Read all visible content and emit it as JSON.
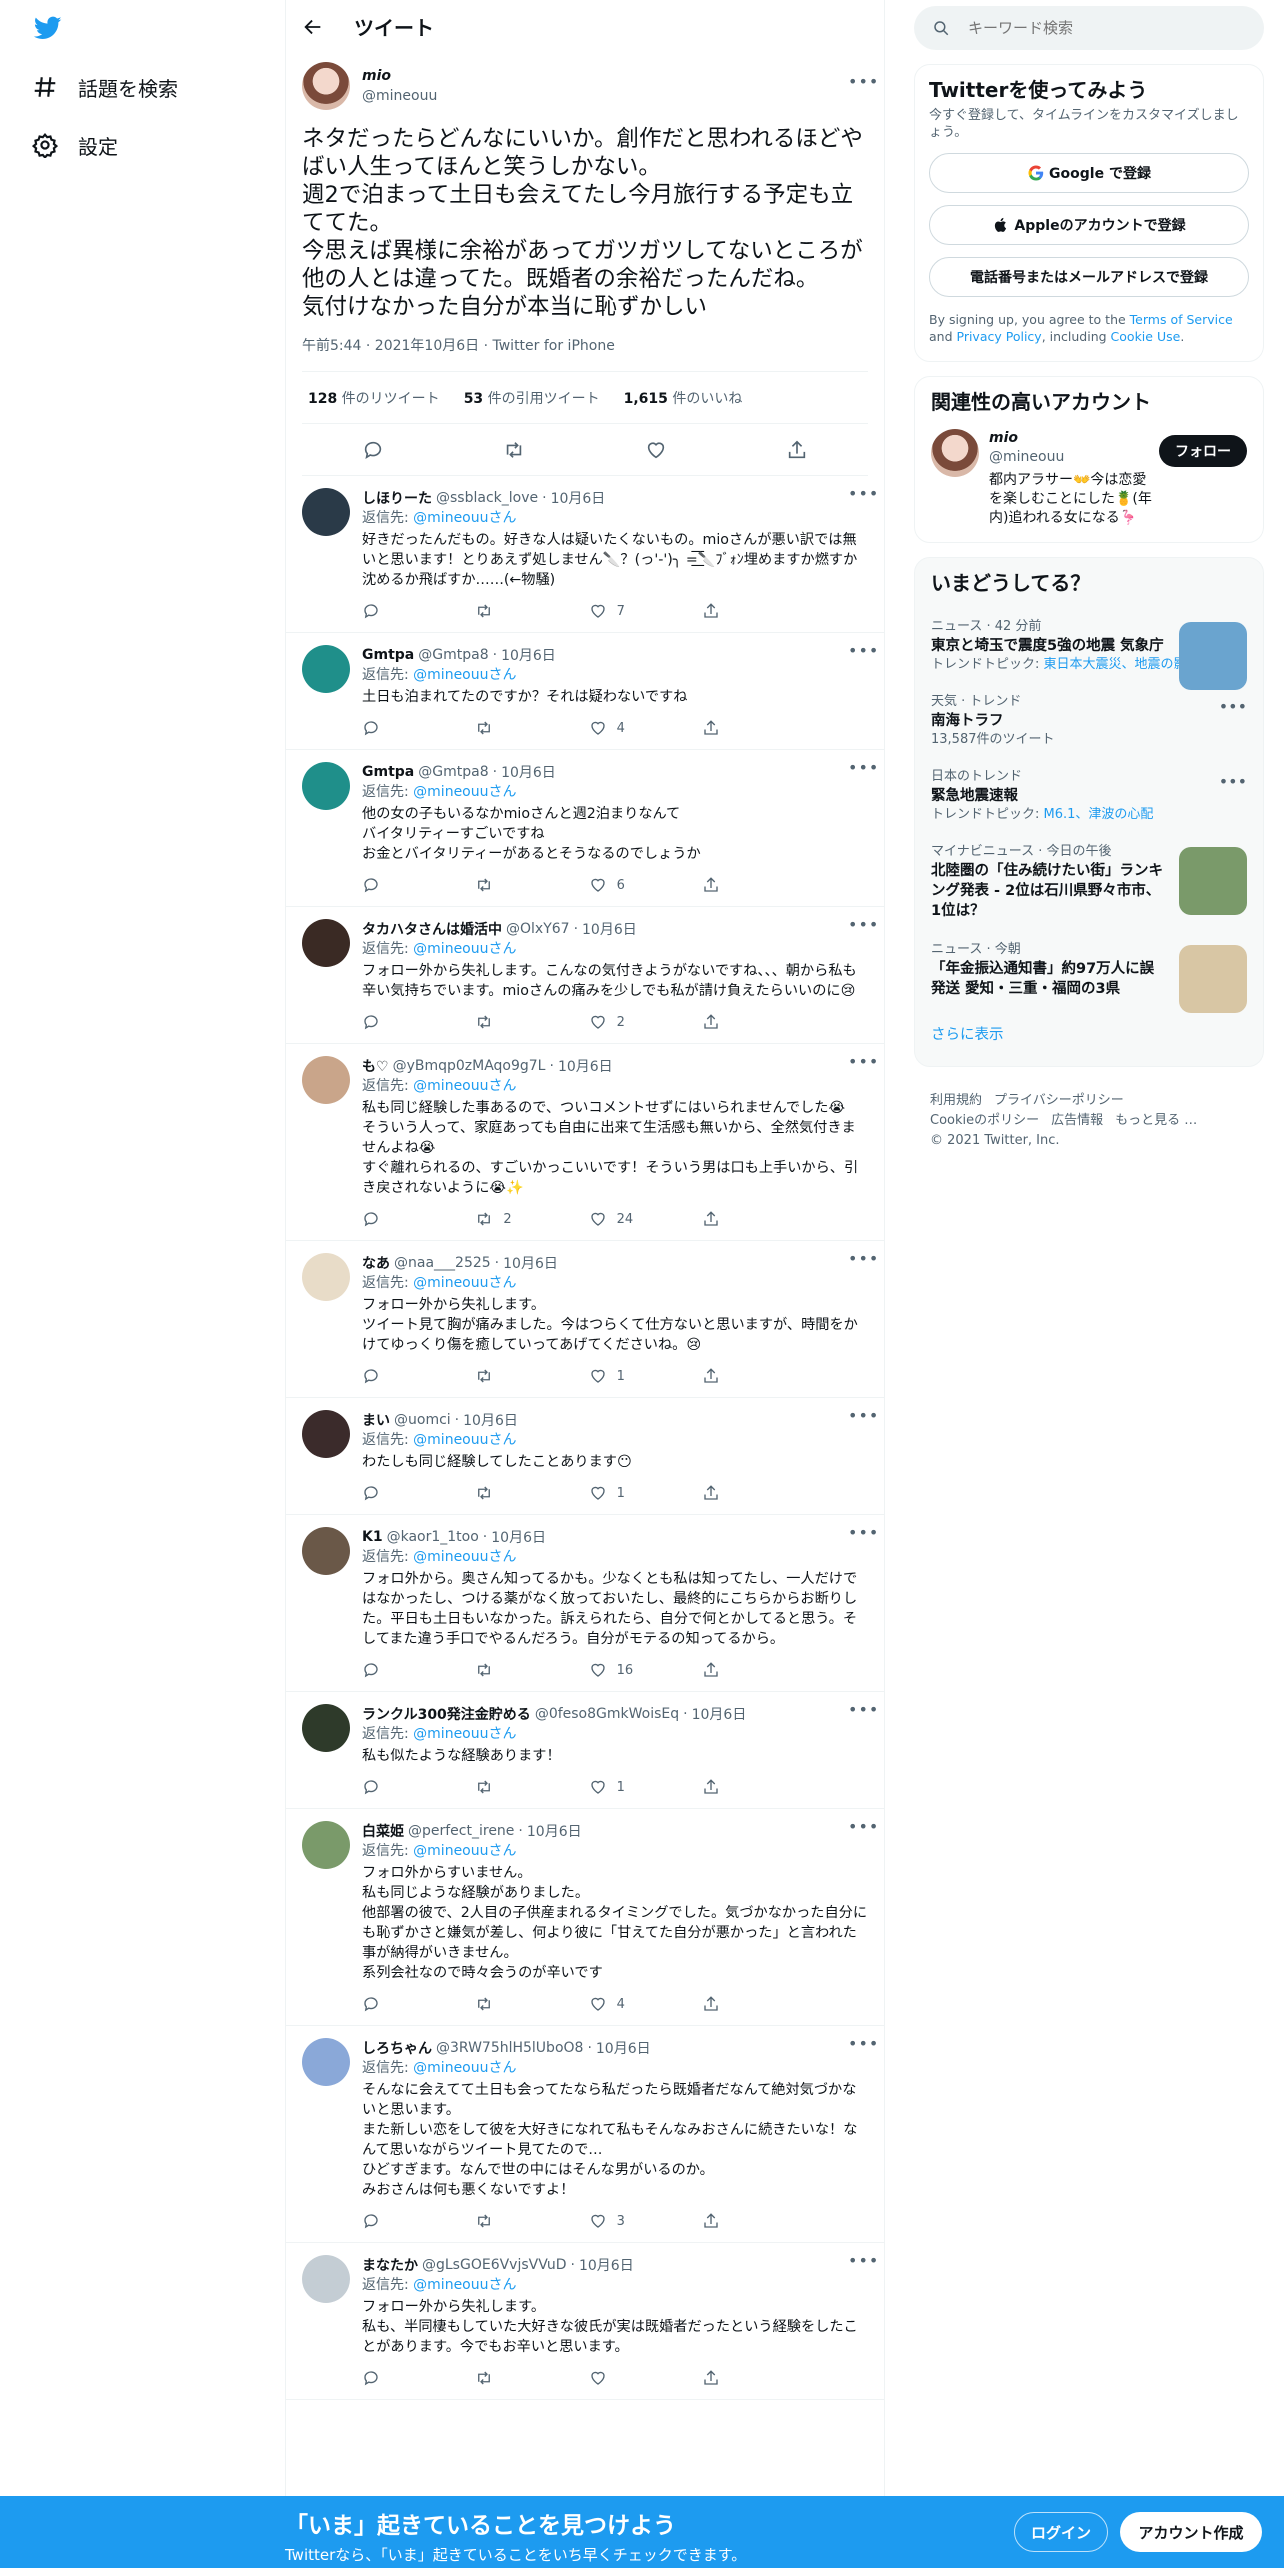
{
  "colors": {
    "brand": "#1d9bf0",
    "text": "#0f1419",
    "muted": "#536471"
  },
  "nav": {
    "logo_icon": "twitter-bird-icon",
    "explore_label": "話題を検索",
    "settings_label": "設定"
  },
  "header": {
    "title": "ツイート"
  },
  "main_tweet": {
    "name": "mio",
    "handle": "@mineouu",
    "text": "ネタだったらどんなにいいか。創作だと思われるほどやばい人生ってほんと笑うしかない。\n週2で泊まって土日も会えてたし今月旅行する予定も立ててた。\n今思えば異様に余裕があってガツガツしてないところが他の人とは違ってた。既婚者の余裕だったんだね。\n気付けなかった自分が本当に恥ずかしい",
    "meta": "午前5:44 · 2021年10月6日 · Twitter for iPhone",
    "retweets_num": "128",
    "retweets_label": " 件のリツイート",
    "quotes_num": "53",
    "quotes_label": " 件の引用ツイート",
    "likes_num": "1,615",
    "likes_label": " 件のいいね"
  },
  "replies": [
    {
      "name": "しほりーた",
      "handle": "@ssblack_love",
      "date": "10月6日",
      "reply_prefix": "返信先: ",
      "reply_to": "@mineouuさん",
      "text": "好きだったんだもの。好きな人は疑いたくないもの。mioさんが悪い訳では無いと思います！とりあえず処しません🔪？(っ'-')╮ =͟͟͞͞🔪ﾌﾞｫﾝ埋めますか燃すか沈めるか飛ばすか……(←物騒)",
      "likes": "7",
      "retweets": "",
      "replies": "",
      "avatar_color": "#2a3a48"
    },
    {
      "name": "Gmtpa",
      "handle": "@Gmtpa8",
      "date": "10月6日",
      "reply_prefix": "返信先: ",
      "reply_to": "@mineouuさん",
      "text": "土日も泊まれてたのですか？それは疑わないですね",
      "likes": "4",
      "retweets": "",
      "replies": "",
      "avatar_color": "#1f8f8a"
    },
    {
      "name": "Gmtpa",
      "handle": "@Gmtpa8",
      "date": "10月6日",
      "reply_prefix": "返信先: ",
      "reply_to": "@mineouuさん",
      "text": "他の女の子もいるなかmioさんと週2泊まりなんて\nバイタリティーすごいですね\nお金とバイタリティーがあるとそうなるのでしょうか",
      "likes": "6",
      "retweets": "",
      "replies": "",
      "avatar_color": "#1f8f8a"
    },
    {
      "name": "タカハタさんは婚活中",
      "handle": "@OlxY67",
      "date": "10月6日",
      "reply_prefix": "返信先: ",
      "reply_to": "@mineouuさん",
      "text": "フォロー外から失礼します。こんなの気付きようがないですね、、、朝から私も辛い気持ちでいます。mioさんの痛みを少しでも私が請け負えたらいいのに😢",
      "likes": "2",
      "retweets": "",
      "replies": "",
      "avatar_color": "#3a2a24"
    },
    {
      "name": "も♡",
      "handle": "@yBmqp0zMAqo9g7L",
      "date": "10月6日",
      "reply_prefix": "返信先: ",
      "reply_to": "@mineouuさん",
      "text": "私も同じ経験した事あるので、ついコメントせずにはいられませんでした😭\nそういう人って、家庭あっても自由に出来て生活感も無いから、全然気付きませんよね😭\nすぐ離れられるの、すごいかっこいいです！そういう男は口も上手いから、引き戻されないように😭✨",
      "likes": "24",
      "retweets": "2",
      "replies": "",
      "avatar_color": "#c9a58a"
    },
    {
      "name": "なあ",
      "handle": "@naa___2525",
      "date": "10月6日",
      "reply_prefix": "返信先: ",
      "reply_to": "@mineouuさん",
      "text": "フォロー外から失礼します。\nツイート見て胸が痛みました。今はつらくて仕方ないと思いますが、時間をかけてゆっくり傷を癒していってあげてくださいね。😢",
      "likes": "1",
      "retweets": "",
      "replies": "",
      "avatar_color": "#e8dcc8"
    },
    {
      "name": "まい",
      "handle": "@uomci",
      "date": "10月6日",
      "reply_prefix": "返信先: ",
      "reply_to": "@mineouuさん",
      "text": "わたしも同じ経験してしたことあります😶",
      "likes": "1",
      "retweets": "",
      "replies": "",
      "avatar_color": "#3b2b2b"
    },
    {
      "name": "K1",
      "handle": "@kaor1_1too",
      "date": "10月6日",
      "reply_prefix": "返信先: ",
      "reply_to": "@mineouuさん",
      "text": "フォロ外から。奥さん知ってるかも。少なくとも私は知ってたし、一人だけではなかったし、つける薬がなく放っておいたし、最終的にこちらからお断りした。平日も土日もいなかった。訴えられたら、自分で何とかしてると思う。そしてまた違う手口でやるんだろう。自分がモテるの知ってるから。",
      "likes": "16",
      "retweets": "",
      "replies": "",
      "avatar_color": "#6a5848"
    },
    {
      "name": "ランクル300発注金貯める",
      "handle": "@0feso8GmkWoisEq",
      "date": "10月6日",
      "reply_prefix": "返信先: ",
      "reply_to": "@mineouuさん",
      "text": "私も似たような経験あります！",
      "likes": "1",
      "retweets": "",
      "replies": "",
      "avatar_color": "#2e3a2a"
    },
    {
      "name": "白菜姫",
      "handle": "@perfect_irene",
      "date": "10月6日",
      "reply_prefix": "返信先: ",
      "reply_to": "@mineouuさん",
      "text": "フォロ外からすいません。\n私も同じような経験がありました。\n他部署の彼で、2人目の子供産まれるタイミングでした。気づかなかった自分にも恥ずかさと嫌気が差し、何より彼に「甘えてた自分が悪かった」と言われた事が納得がいきません。\n系列会社なので時々会うのが辛いです",
      "likes": "4",
      "retweets": "",
      "replies": "",
      "avatar_color": "#7a9a6a"
    },
    {
      "name": "しろちゃん",
      "handle": "@3RW75hlH5lUboO8",
      "date": "10月6日",
      "reply_prefix": "返信先: ",
      "reply_to": "@mineouuさん",
      "text": "そんなに会えてて土日も会ってたなら私だったら既婚者だなんて絶対気づかないと思います。\nまた新しい恋をして彼を大好きになれて私もそんなみおさんに続きたいな！なんて思いながらツイート見てたので…\nひどすぎます。なんで世の中にはそんな男がいるのか。\nみおさんは何も悪くないですよ！",
      "likes": "3",
      "retweets": "",
      "replies": "",
      "avatar_color": "#8aa8d8"
    },
    {
      "name": "まなたか",
      "handle": "@gLsGOE6VvjsVVuD",
      "date": "10月6日",
      "reply_prefix": "返信先: ",
      "reply_to": "@mineouuさん",
      "text": "フォロー外から失礼します。\n私も、半同棲もしていた大好きな彼氏が実は既婚者だったという経験をしたことがあります。今でもお辛いと思います。",
      "likes": "",
      "retweets": "",
      "replies": "",
      "avatar_color": "#c4cdd4"
    }
  ],
  "search": {
    "placeholder": "キーワード検索"
  },
  "signup": {
    "title": "Twitterを使ってみよう",
    "subtitle": "今すぐ登録して、タイムラインをカスタマイズしましょう。",
    "google": "Google で登録",
    "apple": "Appleのアカウントで登録",
    "phone": "電話番号またはメールアドレスで登録",
    "terms_pre": "By signing up, you agree to the ",
    "terms_tos": "Terms of Service",
    "terms_and": " and ",
    "terms_privacy": "Privacy Policy",
    "terms_inc": ", including ",
    "terms_cookie": "Cookie Use",
    "terms_end": "."
  },
  "related": {
    "title": "関連性の高いアカウント",
    "name": "mio",
    "handle": "@mineouu",
    "bio": "都内アラサー👐今は恋愛を楽しむことにした🍍(年内)追われる女になる🦩",
    "follow": "フォロー"
  },
  "trends": {
    "title": "いまどうしてる？",
    "items": [
      {
        "meta": "ニュース · 42 分前",
        "title": "東京と埼玉で震度5強の地震 気象庁",
        "sub_pre": "トレンドトピック: ",
        "sub_link": "東日本大震災、地震の影響",
        "image": true,
        "more": false
      },
      {
        "meta": "天気 · トレンド",
        "title": "南海トラフ",
        "sub_pre": "13,587件のツイート",
        "sub_link": "",
        "image": false,
        "more": true
      },
      {
        "meta": "日本のトレンド",
        "title": "緊急地震速報",
        "sub_pre": "トレンドトピック: ",
        "sub_link": "M6.1、津波の心配",
        "image": false,
        "more": true
      },
      {
        "meta": "マイナビニュース · 今日の午後",
        "title": "北陸圏の「住み続けたい街」ランキング発表 - 2位は石川県野々市市、1位は？",
        "sub_pre": "",
        "sub_link": "",
        "image": true,
        "more": false
      },
      {
        "meta": "ニュース · 今朝",
        "title": "「年金振込通知書」約97万人に誤発送 愛知・三重・福岡の3県",
        "sub_pre": "",
        "sub_link": "",
        "image": true,
        "more": false
      }
    ],
    "show_more": "さらに表示"
  },
  "footer": {
    "terms": "利用規約",
    "privacy": "プライバシーポリシー",
    "cookie": "Cookieのポリシー",
    "ads": "広告情報",
    "more": "もっと見る …",
    "copyright": "© 2021 Twitter, Inc."
  },
  "bottombar": {
    "headline": "「いま」起きていることを見つけよう",
    "sub": "Twitterなら、「いま」起きていることをいち早くチェックできます。",
    "login": "ログイン",
    "signup": "アカウント作成"
  }
}
